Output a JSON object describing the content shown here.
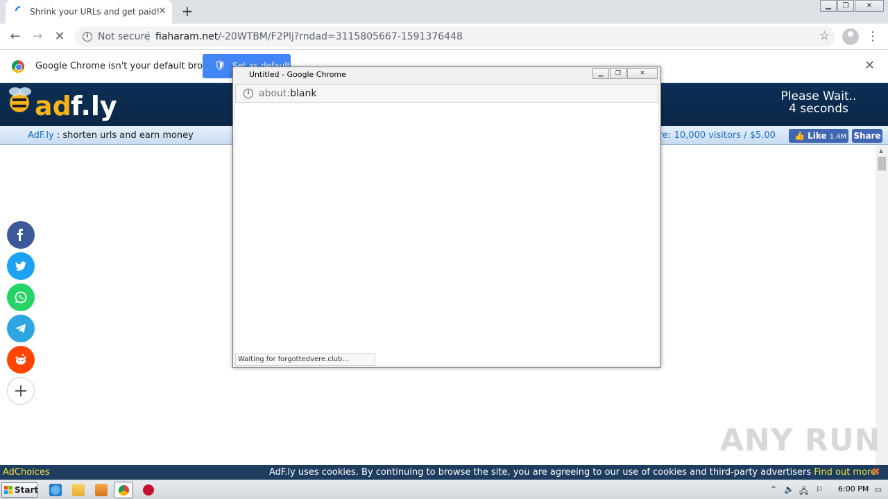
{
  "browser": {
    "tab_title": "Shrink your URLs and get paid!",
    "tab_close": "✕",
    "new_tab": "+",
    "security_label": "Not secure",
    "url_host": "fiaharam.net",
    "url_path": "/-20WTBM/F2Plj?rndad=3115805667-1591376448",
    "infobar_message": "Google Chrome isn't your default browser",
    "infobar_button": "Set as default",
    "infobar_close": "✕"
  },
  "adfly": {
    "logo_text": "adf.ly",
    "please_wait": "Please Wait..",
    "countdown": "4 seconds",
    "tagline_brand": "AdF.ly",
    "tagline_rest": " : shorten urls and earn money",
    "rate_text": "re: 10,000 visitors / $5.00",
    "fb_like": "Like",
    "fb_like_count": "1.4M",
    "fb_share": "Share"
  },
  "social": [
    {
      "name": "facebook",
      "color": "#3b5998"
    },
    {
      "name": "twitter",
      "color": "#1da1f2"
    },
    {
      "name": "whatsapp",
      "color": "#25d366"
    },
    {
      "name": "telegram",
      "color": "#2ca5e0"
    },
    {
      "name": "reddit",
      "color": "#ff4500"
    },
    {
      "name": "more",
      "color": "#ffffff"
    }
  ],
  "popup": {
    "title": "Untitled - Google Chrome",
    "url_scheme": "about:",
    "url_rest": "blank",
    "status": "Waiting for forgottedvere.club..."
  },
  "cookie": {
    "adchoices": "AdChoices",
    "text": "AdF.ly uses cookies. By continuing to browse the site, you are agreeing to our use of cookies and third-party advertisers ",
    "link": "Find out more.",
    "close": "✖"
  },
  "taskbar": {
    "start": "Start",
    "clock": "6:00 PM"
  },
  "watermark": "ANY RUN"
}
